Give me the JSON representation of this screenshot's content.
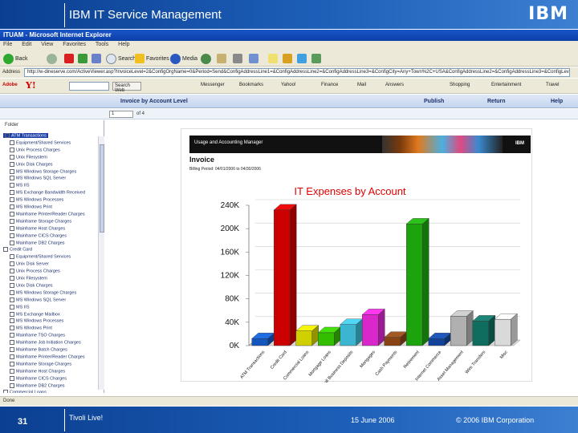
{
  "slide": {
    "title": "IBM IT Service Management",
    "logo": "IBM",
    "page_number": "31",
    "footer_left": "Tivoli Live!",
    "footer_date": "15 June 2006",
    "footer_copyright": "© 2006 IBM Corporation"
  },
  "browser": {
    "window_title": "ITUAM - Microsoft Internet Explorer",
    "menu": [
      "File",
      "Edit",
      "View",
      "Favorites",
      "Tools",
      "Help"
    ],
    "toolbar": {
      "back": "Back",
      "search": "Search",
      "favorites": "Favorites",
      "media": "Media"
    },
    "address_label": "Address",
    "address_url": "http://w-dineserve.com/ActiveViewer.asp?InvoiceLevel=2&ConfigOrgName=0&Period=Send&ConfigAddressLine1=&ConfigAddressLine2=&ConfigAddressLine3=&ConfigCity=Any+Town%2C+USA&ConfigAddressLine2=&ConfigAddressLine3=&ConfigLevel=4=80&InvoiceNumber=&ServerNode=www.chesa",
    "links": {
      "adobe": "Adobe",
      "yahoo": "Y!",
      "search_web": "Search Web",
      "messenger": "Messenger",
      "bookmarks": "Bookmarks",
      "yahoo_link": "Yahoo!",
      "finance": "Finance",
      "mail": "Mail",
      "answers": "Answers",
      "shopping": "Shopping",
      "entertainment": "Entertainment",
      "travel": "Travel"
    },
    "status": "Done"
  },
  "report_nav": {
    "title": "Invoice by Account Level",
    "publish": "Publish",
    "return": "Return",
    "help": "Help",
    "page_value": "1",
    "page_of": "of 4"
  },
  "tree": {
    "label": "Folder",
    "items": [
      {
        "label": "ATM Transactions",
        "selected": true,
        "indent": 0
      },
      {
        "label": "Equipment/Shared Services",
        "indent": 1
      },
      {
        "label": "Unix Process Charges",
        "indent": 1
      },
      {
        "label": "Unix Filesystem",
        "indent": 1
      },
      {
        "label": "Unix Disk Charges",
        "indent": 1
      },
      {
        "label": "MS Windows Storage Charges",
        "indent": 1
      },
      {
        "label": "MS Windows SQL Server",
        "indent": 1
      },
      {
        "label": "MS IIS",
        "indent": 1
      },
      {
        "label": "MS Exchange Bandwidth Received",
        "indent": 1
      },
      {
        "label": "MS Windows Processes",
        "indent": 1
      },
      {
        "label": "MS Windows Print",
        "indent": 1
      },
      {
        "label": "Mainframe Printer/Reader Charges",
        "indent": 1
      },
      {
        "label": "Mainframe Storage Charges",
        "indent": 1
      },
      {
        "label": "Mainframe Host Charges",
        "indent": 1
      },
      {
        "label": "Mainframe CICS Charges",
        "indent": 1
      },
      {
        "label": "Mainframe DB2 Charges",
        "indent": 1
      },
      {
        "label": "Credit Card",
        "indent": 0
      },
      {
        "label": "Equipment/Shared Services",
        "indent": 1
      },
      {
        "label": "Unix Disk Server",
        "indent": 1
      },
      {
        "label": "Unix Process Charges",
        "indent": 1
      },
      {
        "label": "Unix Filesystem",
        "indent": 1
      },
      {
        "label": "Unix Disk Charges",
        "indent": 1
      },
      {
        "label": "MS Windows Storage Charges",
        "indent": 1
      },
      {
        "label": "MS Windows SQL Server",
        "indent": 1
      },
      {
        "label": "MS IIS",
        "indent": 1
      },
      {
        "label": "MS Exchange Mailbox",
        "indent": 1
      },
      {
        "label": "MS Windows Processes",
        "indent": 1
      },
      {
        "label": "MS Windows Print",
        "indent": 1
      },
      {
        "label": "Mainframe TSO Charges",
        "indent": 1
      },
      {
        "label": "Mainframe Job Initiation Charges",
        "indent": 1
      },
      {
        "label": "Mainframe Batch Charges",
        "indent": 1
      },
      {
        "label": "Mainframe Printer/Reader Charges",
        "indent": 1
      },
      {
        "label": "Mainframe Storage Charges",
        "indent": 1
      },
      {
        "label": "Mainframe Host Charges",
        "indent": 1
      },
      {
        "label": "Mainframe CICS Charges",
        "indent": 1
      },
      {
        "label": "Mainframe DB2 Charges",
        "indent": 1
      },
      {
        "label": "Commercial Loans",
        "indent": 0
      }
    ]
  },
  "report": {
    "banner": "Usage and Accounting Manager",
    "banner_logo": "IBM",
    "heading": "Invoice",
    "period": "Billing Period: 04/01/2006 to 04/30/2006"
  },
  "chart_data": {
    "type": "bar",
    "title": "IT Expenses by Account",
    "categories": [
      "ATM Transactions",
      "Credit Card",
      "Commercial Loans",
      "Mortgage Loans",
      "Small Business Deposits",
      "Mortgages",
      "Cash Payments",
      "Retirement",
      "Internet Commerce",
      "Asset Management",
      "Wire Transfers",
      "Misc"
    ],
    "values": [
      12000,
      232000,
      25000,
      22000,
      36000,
      53000,
      14000,
      208000,
      12000,
      50000,
      42000,
      45000
    ],
    "colors": [
      "#1565e0",
      "#f00000",
      "#f5f500",
      "#3ce000",
      "#46d6f5",
      "#ff2ef0",
      "#a05018",
      "#22c010",
      "#1650b8",
      "#cfcfcf",
      "#128070",
      "#ffffff"
    ],
    "y_ticks": [
      "0K",
      "40K",
      "80K",
      "120K",
      "160K",
      "200K",
      "240K"
    ],
    "ylim": [
      0,
      240000
    ]
  }
}
